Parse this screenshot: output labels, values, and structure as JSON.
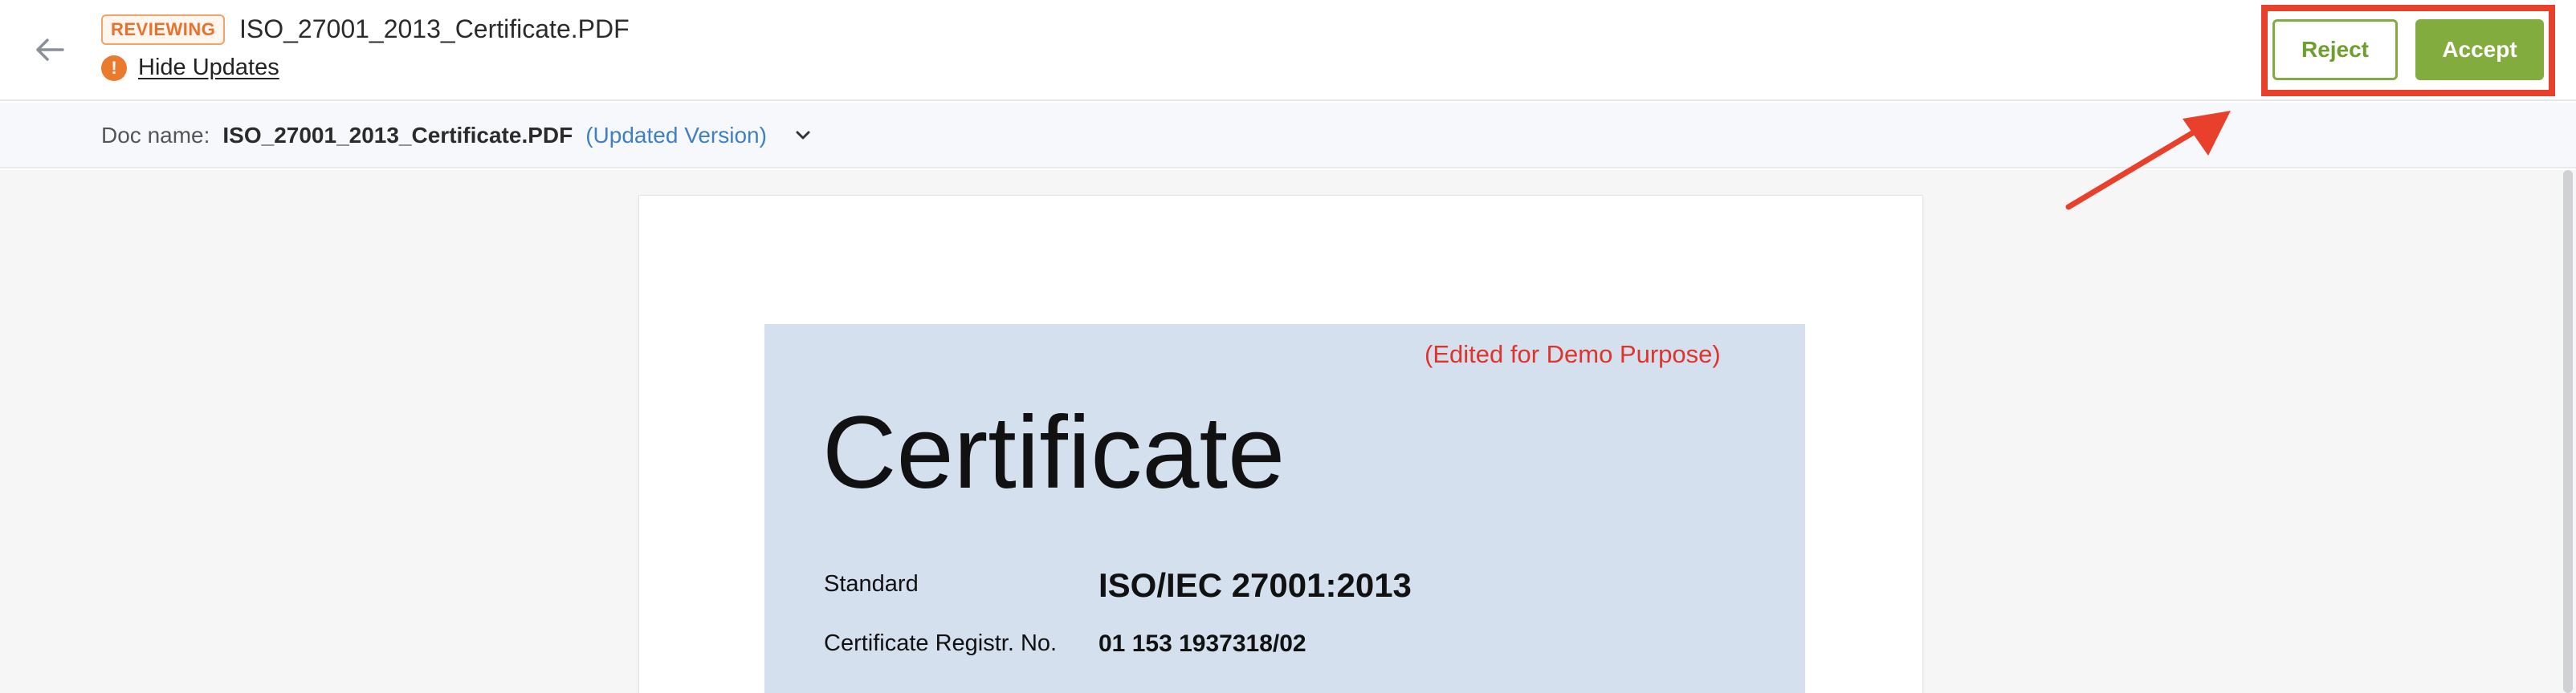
{
  "header": {
    "status_badge": "REVIEWING",
    "file_title": "ISO_27001_2013_Certificate.PDF",
    "hide_updates_label": "Hide Updates",
    "reject_label": "Reject",
    "accept_label": "Accept"
  },
  "doc_bar": {
    "label": "Doc name:",
    "name": "ISO_27001_2013_Certificate.PDF",
    "version": "(Updated Version)"
  },
  "certificate": {
    "demo_note": "(Edited for Demo Purpose)",
    "title": "Certificate",
    "standard_label": "Standard",
    "standard_value": "ISO/IEC 27001:2013",
    "registration_label": "Certificate Registr. No.",
    "registration_value": "01 153 1937318/02"
  },
  "colors": {
    "accent_green": "#82ac3e",
    "annotation_red": "#e8402a",
    "badge_orange": "#e8722c",
    "link_blue": "#3f7fc4",
    "certificate_bg": "#d4e0ed"
  },
  "icons": {
    "back": "arrow-left-icon",
    "info": "exclamation-circle-icon",
    "dropdown": "chevron-down-icon"
  }
}
